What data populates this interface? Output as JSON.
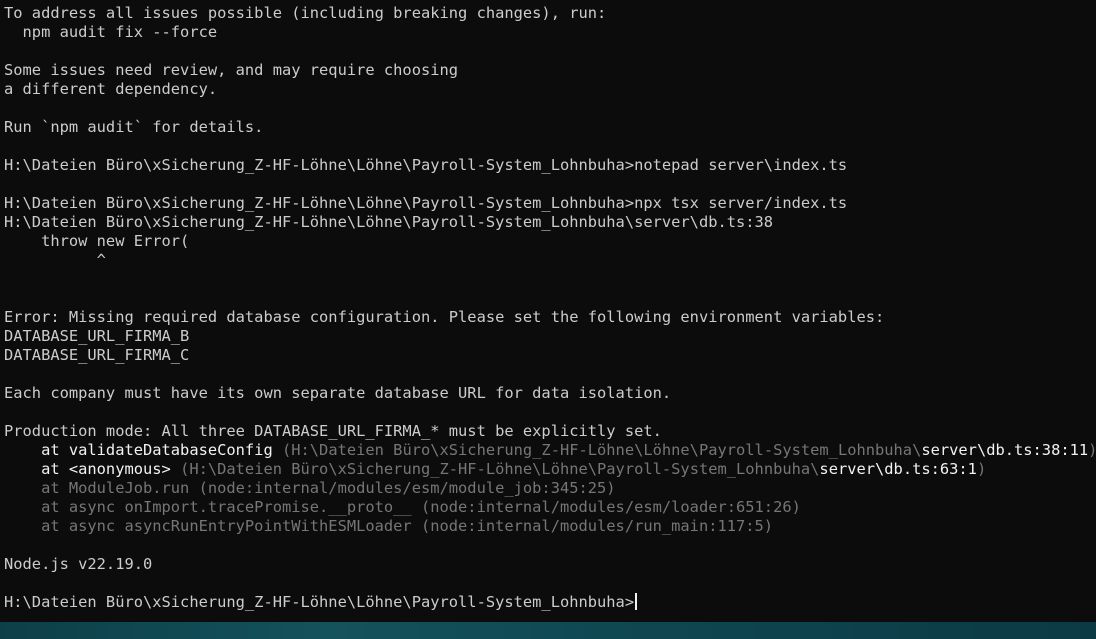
{
  "terminal": {
    "lines": [
      {
        "segments": [
          {
            "text": "To address all issues possible (including breaking changes), run:",
            "style": "normal"
          }
        ]
      },
      {
        "segments": [
          {
            "text": "  npm audit fix --force",
            "style": "normal"
          }
        ]
      },
      {
        "segments": [
          {
            "text": "",
            "style": "normal"
          }
        ]
      },
      {
        "segments": [
          {
            "text": "Some issues need review, and may require choosing",
            "style": "normal"
          }
        ]
      },
      {
        "segments": [
          {
            "text": "a different dependency.",
            "style": "normal"
          }
        ]
      },
      {
        "segments": [
          {
            "text": "",
            "style": "normal"
          }
        ]
      },
      {
        "segments": [
          {
            "text": "Run `npm audit` for details.",
            "style": "normal"
          }
        ]
      },
      {
        "segments": [
          {
            "text": "",
            "style": "normal"
          }
        ]
      },
      {
        "segments": [
          {
            "text": "H:\\Dateien Büro\\xSicherung_Z-HF-Löhne\\Löhne\\Payroll-System_Lohnbuha>notepad server\\index.ts",
            "style": "normal"
          }
        ]
      },
      {
        "segments": [
          {
            "text": "",
            "style": "normal"
          }
        ]
      },
      {
        "segments": [
          {
            "text": "H:\\Dateien Büro\\xSicherung_Z-HF-Löhne\\Löhne\\Payroll-System_Lohnbuha>npx tsx server/index.ts",
            "style": "normal"
          }
        ]
      },
      {
        "segments": [
          {
            "text": "H:\\Dateien Büro\\xSicherung_Z-HF-Löhne\\Löhne\\Payroll-System_Lohnbuha\\server\\db.ts:38",
            "style": "normal"
          }
        ]
      },
      {
        "segments": [
          {
            "text": "    throw new Error(",
            "style": "normal"
          }
        ]
      },
      {
        "segments": [
          {
            "text": "          ^",
            "style": "normal"
          }
        ]
      },
      {
        "segments": [
          {
            "text": "",
            "style": "normal"
          }
        ]
      },
      {
        "segments": [
          {
            "text": "",
            "style": "normal"
          }
        ]
      },
      {
        "segments": [
          {
            "text": "Error: Missing required database configuration. Please set the following environment variables:",
            "style": "normal"
          }
        ]
      },
      {
        "segments": [
          {
            "text": "DATABASE_URL_FIRMA_B",
            "style": "normal"
          }
        ]
      },
      {
        "segments": [
          {
            "text": "DATABASE_URL_FIRMA_C",
            "style": "normal"
          }
        ]
      },
      {
        "segments": [
          {
            "text": "",
            "style": "normal"
          }
        ]
      },
      {
        "segments": [
          {
            "text": "Each company must have its own separate database URL for data isolation.",
            "style": "normal"
          }
        ]
      },
      {
        "segments": [
          {
            "text": "",
            "style": "normal"
          }
        ]
      },
      {
        "segments": [
          {
            "text": "Production mode: All three DATABASE_URL_FIRMA_* must be explicitly set.",
            "style": "normal"
          }
        ]
      },
      {
        "segments": [
          {
            "text": "    at validateDatabaseConfig ",
            "style": "bright"
          },
          {
            "text": "(H:\\Dateien Büro\\xSicherung_Z-HF-Löhne\\Löhne\\Payroll-System_Lohnbuha\\",
            "style": "dim"
          },
          {
            "text": "server\\db.ts:38:11",
            "style": "bright"
          },
          {
            "text": ")",
            "style": "dim"
          }
        ]
      },
      {
        "segments": [
          {
            "text": "    at <anonymous> ",
            "style": "bright"
          },
          {
            "text": "(H:\\Dateien Büro\\xSicherung_Z-HF-Löhne\\Löhne\\Payroll-System_Lohnbuha\\",
            "style": "dim"
          },
          {
            "text": "server\\db.ts:63:1",
            "style": "bright"
          },
          {
            "text": ")",
            "style": "dim"
          }
        ]
      },
      {
        "segments": [
          {
            "text": "    at ModuleJob.run (node:internal/modules/esm/module_job:345:25)",
            "style": "dim"
          }
        ]
      },
      {
        "segments": [
          {
            "text": "    at async onImport.tracePromise.__proto__ (node:internal/modules/esm/loader:651:26)",
            "style": "dim"
          }
        ]
      },
      {
        "segments": [
          {
            "text": "    at async asyncRunEntryPointWithESMLoader (node:internal/modules/run_main:117:5)",
            "style": "dim"
          }
        ]
      },
      {
        "segments": [
          {
            "text": "",
            "style": "normal"
          }
        ]
      },
      {
        "segments": [
          {
            "text": "Node.js v22.19.0",
            "style": "normal"
          }
        ]
      },
      {
        "segments": [
          {
            "text": "",
            "style": "normal"
          }
        ]
      },
      {
        "segments": [
          {
            "text": "H:\\Dateien Büro\\xSicherung_Z-HF-Löhne\\Löhne\\Payroll-System_Lohnbuha>",
            "style": "normal"
          }
        ],
        "cursor": true
      }
    ]
  },
  "colors": {
    "background": "#0c0c0c",
    "text": "#cccccc",
    "text_bright": "#f2f2f2",
    "text_dim": "#767676",
    "taskbar": "#14525c"
  }
}
